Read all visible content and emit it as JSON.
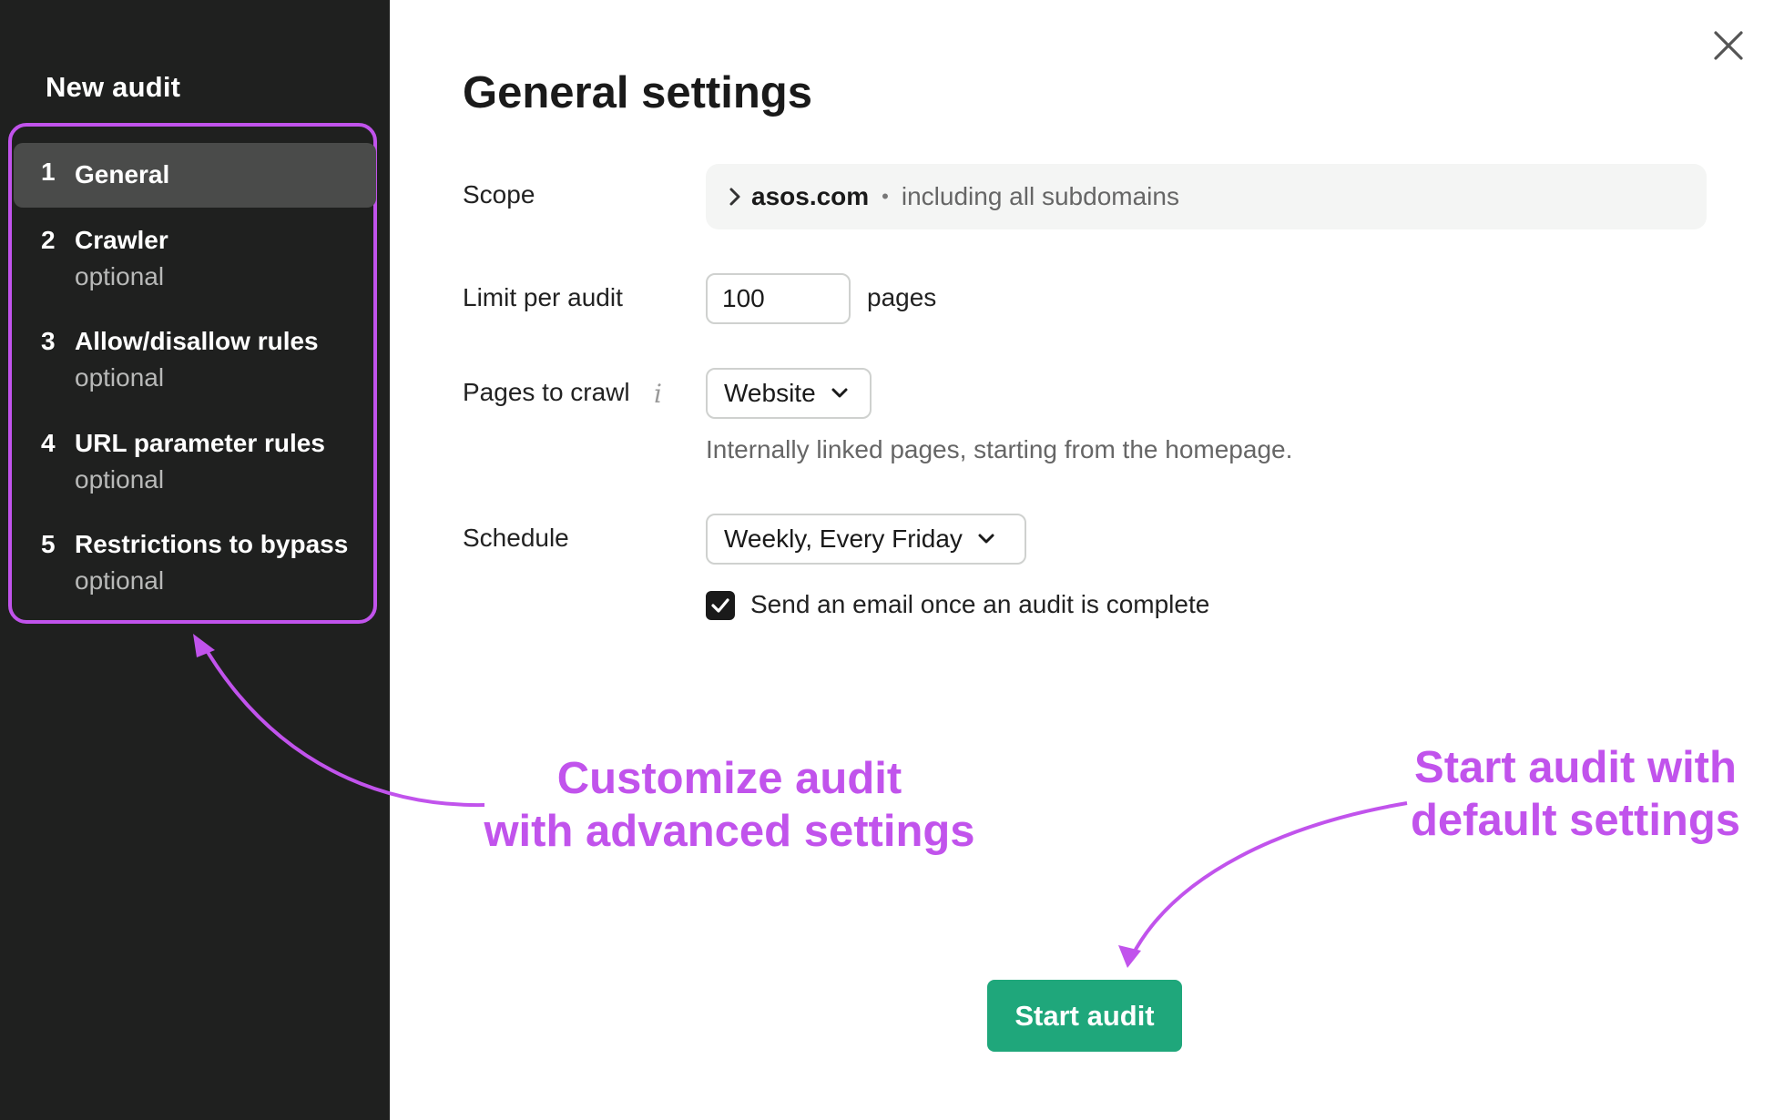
{
  "sidebar": {
    "title": "New audit",
    "steps": [
      {
        "num": "1",
        "label": "General",
        "sub": ""
      },
      {
        "num": "2",
        "label": "Crawler",
        "sub": "optional"
      },
      {
        "num": "3",
        "label": "Allow/disallow rules",
        "sub": "optional"
      },
      {
        "num": "4",
        "label": "URL parameter rules",
        "sub": "optional"
      },
      {
        "num": "5",
        "label": "Restrictions to bypass",
        "sub": "optional"
      }
    ]
  },
  "main": {
    "title": "General settings",
    "scope": {
      "label": "Scope",
      "domain": "asos.com",
      "separator": "•",
      "detail": "including all subdomains"
    },
    "limit": {
      "label": "Limit per audit",
      "value": "100",
      "suffix": "pages"
    },
    "pages_to_crawl": {
      "label": "Pages to crawl",
      "info_glyph": "i",
      "selected": "Website",
      "help": "Internally linked pages, starting from the homepage."
    },
    "schedule": {
      "label": "Schedule",
      "selected": "Weekly, Every Friday"
    },
    "email": {
      "label": "Send an email once an audit is complete",
      "checked": true
    },
    "start_button": "Start audit"
  },
  "annotations": {
    "left_line1": "Customize audit",
    "left_line2": "with advanced settings",
    "right_line1": "Start audit with",
    "right_line2": "default settings",
    "color": "#c153ec"
  },
  "icons": {
    "close": "close-icon",
    "chevron_right": "chevron-right-icon",
    "chevron_down": "chevron-down-icon",
    "check": "check-icon",
    "info": "info-icon"
  },
  "colors": {
    "sidebar_bg": "#1f201f",
    "active_step_bg": "#4a4b4a",
    "accent": "#1fa77b",
    "annotation": "#c153ec"
  }
}
